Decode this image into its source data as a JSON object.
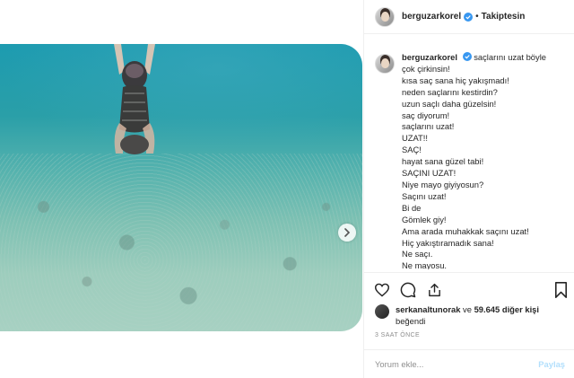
{
  "post": {
    "username": "berguzarkorel",
    "follow_label": "Takiptesin",
    "separator": "•",
    "caption_lines": [
      "saçlarını uzat böyle",
      "çok çirkinsin!",
      "kısa saç sana hiç yakışmadı!",
      "neden saçlarını kestirdin?",
      "uzun saçlı daha güzelsin!",
      "saç diyorum!",
      "saçlarını uzat!",
      "UZAT!!",
      "SAÇ!",
      "hayat sana güzel tabi!",
      "SAÇINI UZAT!",
      "Niye mayo giyiyosun?",
      "Saçını uzat!",
      "Bi de",
      "Gömlek giy!",
      "Ama arada muhakkak saçını uzat!",
      "Hiç yakıştıramadık sana!",
      "Ne saçı.",
      "Ne mayosu."
    ],
    "likes": {
      "first_user": "serkanaltunorak",
      "conjunction": "ve",
      "others": "59.645 diğer kişi",
      "suffix": "beğendi"
    },
    "timestamp": "3 SAAT ÖNCE",
    "comment": {
      "placeholder": "Yorum ekle...",
      "value": "",
      "post_label": "Paylaş"
    }
  },
  "icons": {
    "verified": "verified-badge-icon",
    "like": "heart-icon",
    "comment": "comment-bubble-icon",
    "share": "share-icon",
    "save": "bookmark-icon",
    "carousel_next": "chevron-right-icon"
  },
  "colors": {
    "verified_blue": "#3897f0",
    "post_button": "#b2dffc",
    "muted_text": "#8e8e8e",
    "border": "#efefef"
  }
}
